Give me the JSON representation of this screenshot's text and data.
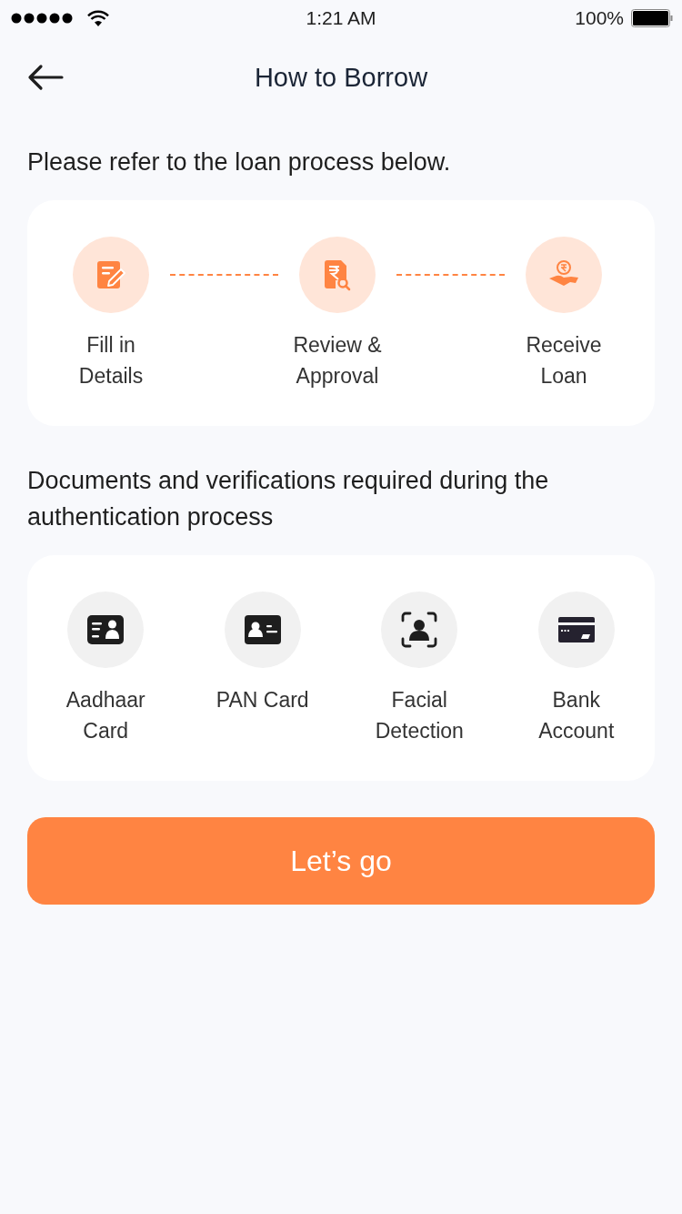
{
  "status_bar": {
    "time": "1:21 AM",
    "battery": "100%"
  },
  "nav": {
    "title": "How to Borrow"
  },
  "process": {
    "heading": "Please refer to the loan process below.",
    "steps": [
      {
        "kind": "form",
        "label": "Fill in Details"
      },
      {
        "kind": "review",
        "label": "Review & Approval"
      },
      {
        "kind": "receive",
        "label": "Receive Loan"
      }
    ]
  },
  "documents": {
    "heading": "Documents and verifications required during the authentication process",
    "items": [
      {
        "kind": "id-card",
        "label": "Aadhaar Card"
      },
      {
        "kind": "pan-card",
        "label": "PAN Card"
      },
      {
        "kind": "face",
        "label": "Facial Detection"
      },
      {
        "kind": "bank",
        "label": "Bank Account"
      }
    ]
  },
  "button": {
    "label": "Let’s go"
  }
}
